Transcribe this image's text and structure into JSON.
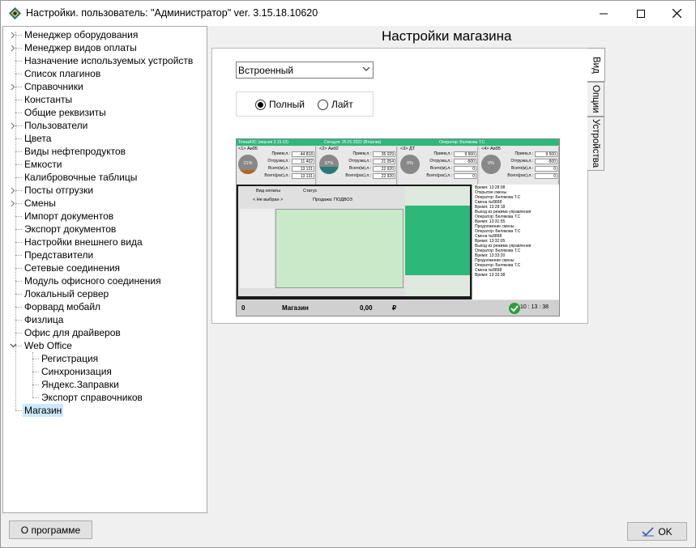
{
  "window": {
    "title": "Настройки. пользователь: \"Администратор\" ver. 3.15.18.10620"
  },
  "tree": {
    "items": [
      {
        "label": "Менеджер оборудования",
        "expandable": true
      },
      {
        "label": "Менеджер видов оплаты",
        "expandable": true
      },
      {
        "label": "Назначение используемых устройств",
        "expandable": false
      },
      {
        "label": "Список плагинов",
        "expandable": false
      },
      {
        "label": "Справочники",
        "expandable": true
      },
      {
        "label": "Константы",
        "expandable": false
      },
      {
        "label": "Общие реквизиты",
        "expandable": false
      },
      {
        "label": "Пользователи",
        "expandable": true
      },
      {
        "label": "Цвета",
        "expandable": false
      },
      {
        "label": "Виды нефтепродуктов",
        "expandable": false
      },
      {
        "label": "Емкости",
        "expandable": false
      },
      {
        "label": "Калибровочные таблицы",
        "expandable": false
      },
      {
        "label": "Посты отгрузки",
        "expandable": true
      },
      {
        "label": "Смены",
        "expandable": true
      },
      {
        "label": "Импорт документов",
        "expandable": false
      },
      {
        "label": "Экспорт документов",
        "expandable": false
      },
      {
        "label": "Настройки внешнего вида",
        "expandable": false
      },
      {
        "label": "Представители",
        "expandable": false
      },
      {
        "label": "Сетевые соединения",
        "expandable": false
      },
      {
        "label": "Модуль офисного соединения",
        "expandable": false
      },
      {
        "label": "Локальный сервер",
        "expandable": false
      },
      {
        "label": "Форвард мобайл",
        "expandable": false
      },
      {
        "label": "Физлица",
        "expandable": false
      },
      {
        "label": "Офис для драйверов",
        "expandable": false
      },
      {
        "label": "Web Office",
        "expandable": true,
        "expanded": true
      },
      {
        "label": "Регистрация",
        "child": true
      },
      {
        "label": "Синхронизация",
        "child": true
      },
      {
        "label": "Яндекс.Заправки",
        "child": true
      },
      {
        "label": "Экспорт справочников",
        "child": true
      },
      {
        "label": "Магазин",
        "selected": true
      }
    ]
  },
  "main": {
    "title": "Настройки магазина",
    "mode_select": {
      "value": "Встроенный"
    },
    "radios": [
      {
        "label": "Полный",
        "checked": true
      },
      {
        "label": "Лайт",
        "checked": false
      }
    ],
    "side_tabs": [
      {
        "label": "Вид",
        "active": true
      },
      {
        "label": "Опции",
        "active": false
      },
      {
        "label": "Устройства",
        "active": false
      }
    ]
  },
  "preview": {
    "bar_left": "ТопазАЗС (версия 3.15.03)",
    "bar_mid": "Сегодня: 25.01.2022 (Вторник)",
    "bar_right": "Оператор: Белякова Т.С",
    "tanks": [
      {
        "name": "<1> Аи95",
        "pct": "21%",
        "fill": 0.21,
        "fill_color": "#b5651d",
        "priem": "44 818",
        "otpr": "11 402",
        "vsego1": "13 131",
        "vsego2": "13 131"
      },
      {
        "name": "<2> Аи92",
        "pct": "37%",
        "fill": 0.37,
        "fill_color": "#2a7a7a",
        "priem": "35 029",
        "otpr": "21 054",
        "vsego1": "22 920",
        "vsego2": "22 920"
      },
      {
        "name": "<3> ДТ",
        "pct": "0%",
        "fill": 0,
        "fill_color": "#888888",
        "priem": "9 500",
        "otpr": "-500",
        "vsego1": "0",
        "vsego2": "0"
      },
      {
        "name": "<4> Аи95",
        "pct": "0%",
        "fill": 0,
        "fill_color": "#888888",
        "priem": "9 500",
        "otpr": "-500",
        "vsego1": "0",
        "vsego2": "0"
      }
    ],
    "row_labels": {
      "priem": "Прием,л.:",
      "otpr": "Отгрузка,л.:",
      "vsego1": "Всего(м),л.:",
      "vsego2": "Всего(рас),л.:"
    },
    "grid_header_pay": "Вид оплаты",
    "grid_header_status": "Статус",
    "grid_not_selected": "< Не выбран >",
    "grid_sale": "Продажа: ПОДВОЗ",
    "log": [
      "Время: 13:28:08",
      "Открытие смены",
      "Оператор: Белякова Т.С",
      "Смена №8898",
      "Время: 13:28:18",
      "Выход из режима управления",
      "Оператор: Белякова Т.С",
      "Время: 13:31:55",
      "Продолжение смены",
      "Оператор: Белякова Т.С",
      "Смена №8898",
      "Время: 13:32:05",
      "Выход из режима управления",
      "Оператор: Белякова Т.С",
      "Время: 13:33:20",
      "Продолжение смены",
      "Оператор: Белякова Т.С",
      "Смена №8898",
      "Время: 13:33:38"
    ],
    "bottom": {
      "left_num": "0",
      "shop": "Магазин",
      "amount": "0,00",
      "currency": "₽",
      "time": "10 : 13 : 38"
    }
  },
  "buttons": {
    "about": "О программе",
    "ok": "OK"
  }
}
